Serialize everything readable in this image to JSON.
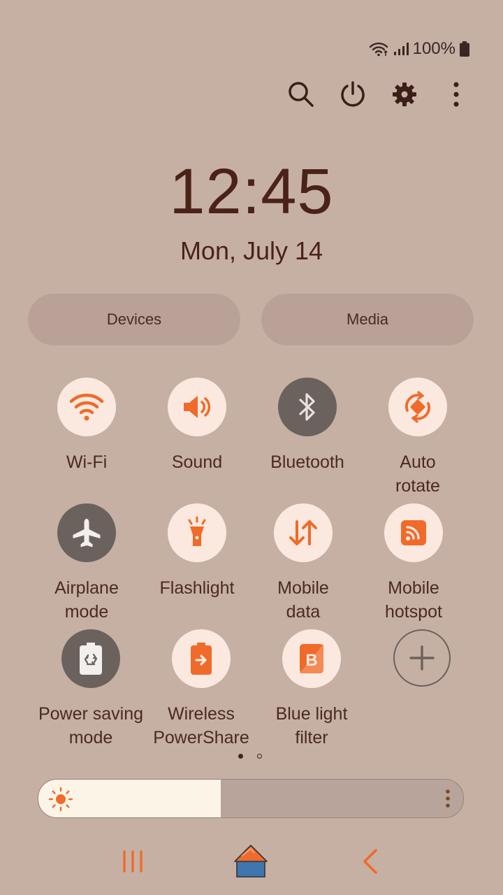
{
  "status": {
    "battery": "100%"
  },
  "clock": {
    "time": "12:45",
    "date": "Mon, July 14"
  },
  "quick_buttons": {
    "devices": "Devices",
    "media": "Media"
  },
  "tiles": [
    {
      "label": "Wi-Fi",
      "icon": "wifi-icon",
      "state": "on"
    },
    {
      "label": "Sound",
      "icon": "speaker-icon",
      "state": "on"
    },
    {
      "label": "Bluetooth",
      "icon": "bluetooth-icon",
      "state": "off"
    },
    {
      "label": "Auto\nrotate",
      "icon": "auto-rotate-icon",
      "state": "on"
    },
    {
      "label": "Airplane\nmode",
      "icon": "airplane-icon",
      "state": "off"
    },
    {
      "label": "Flashlight",
      "icon": "flashlight-icon",
      "state": "on"
    },
    {
      "label": "Mobile\ndata",
      "icon": "mobile-data-icon",
      "state": "on"
    },
    {
      "label": "Mobile\nhotspot",
      "icon": "hotspot-icon",
      "state": "on"
    },
    {
      "label": "Power saving\nmode",
      "icon": "power-saving-icon",
      "state": "off"
    },
    {
      "label": "Wireless\nPowerShare",
      "icon": "wireless-powershare-icon",
      "state": "on"
    },
    {
      "label": "Blue light\nfilter",
      "icon": "blue-light-filter-icon",
      "state": "on"
    },
    {
      "label": "",
      "icon": "add-icon",
      "state": "add"
    }
  ],
  "pages": {
    "count": 2,
    "active": 1
  },
  "brightness": {
    "level": 0.43
  },
  "colors": {
    "accent": "#f06a2a",
    "tile_on": "#fbe9df",
    "tile_off": "#6b625e",
    "background": "#c6b0a3",
    "text": "#4a2a22"
  }
}
